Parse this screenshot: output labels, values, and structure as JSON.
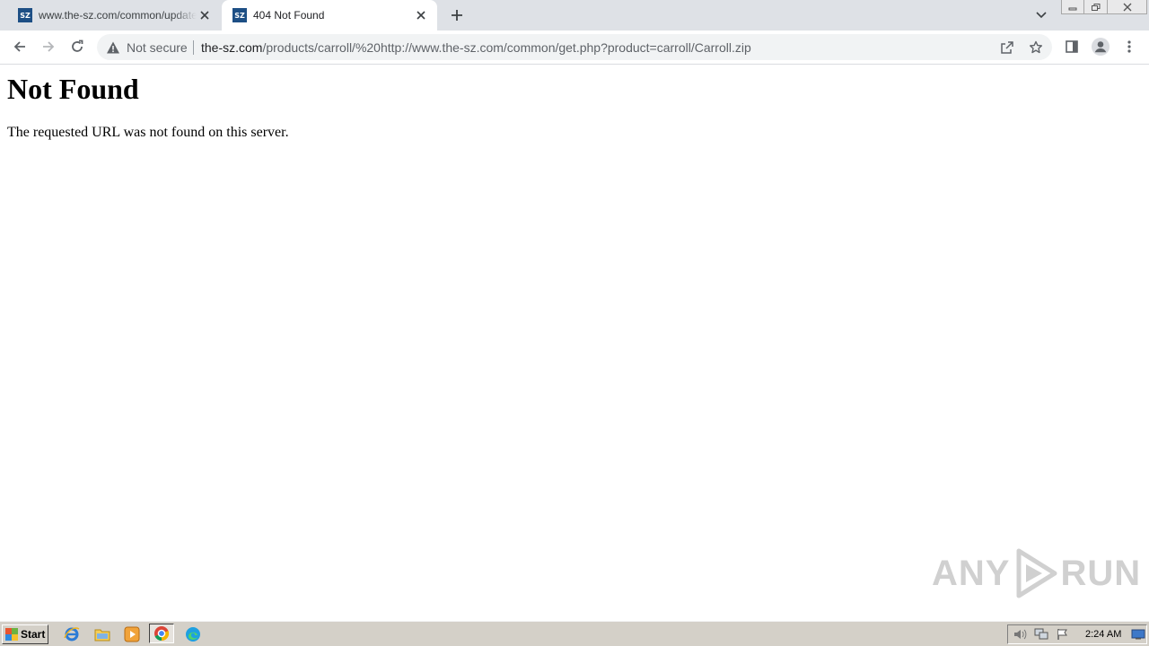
{
  "tabs": [
    {
      "title": "www.the-sz.com/common/update.php",
      "favicon_text": "SZ",
      "active": false
    },
    {
      "title": "404 Not Found",
      "favicon_text": "SZ",
      "active": true
    }
  ],
  "toolbar": {
    "security_label": "Not secure",
    "url_host": "the-sz.com",
    "url_path": "/products/carroll/%20http://www.the-sz.com/common/get.php?product=carroll/Carroll.zip"
  },
  "page": {
    "heading": "Not Found",
    "message": "The requested URL was not found on this server."
  },
  "watermark": {
    "left": "ANY",
    "right": "RUN"
  },
  "taskbar": {
    "start_label": "Start",
    "clock": "2:24 AM"
  },
  "icons": {
    "back": "arrow-left-icon",
    "forward": "arrow-right-icon",
    "reload": "reload-icon",
    "warning": "warning-icon",
    "share": "share-icon",
    "bookmark": "star-icon",
    "sidepanel": "side-panel-icon",
    "profile": "profile-icon",
    "menu": "kebab-menu-icon"
  },
  "colors": {
    "tabstrip": "#dee1e6",
    "omnibox": "#f1f3f4",
    "favicon": "#1d4f85",
    "taskbar": "#d4d0c8"
  }
}
